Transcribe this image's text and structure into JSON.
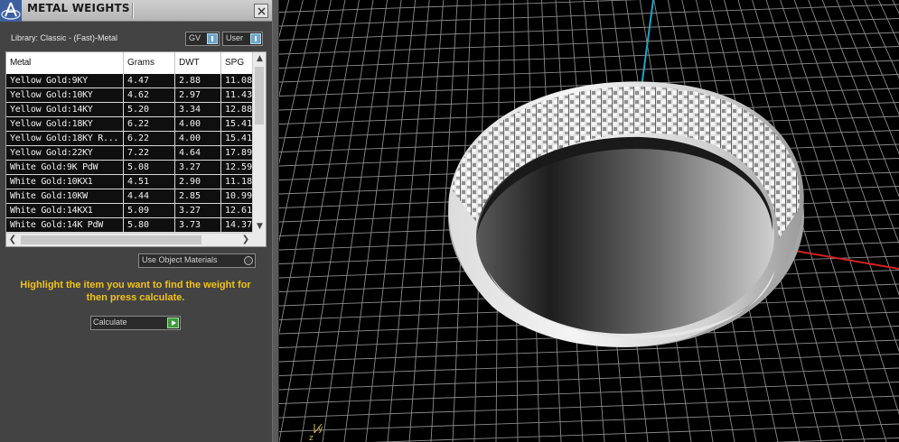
{
  "panel": {
    "title": "METAL WEIGHTS",
    "library_label": "Library: Classic - (Fast)-Metal",
    "toggles": [
      {
        "label": "GV"
      },
      {
        "label": "User"
      }
    ],
    "table": {
      "columns": [
        "Metal",
        "Grams",
        "DWT",
        "SPG"
      ],
      "rows": [
        [
          "Yellow Gold:9KY",
          "4.47",
          "2.88",
          "11.08"
        ],
        [
          "Yellow Gold:10KY",
          "4.62",
          "2.97",
          "11.43"
        ],
        [
          "Yellow Gold:14KY",
          "5.20",
          "3.34",
          "12.88"
        ],
        [
          "Yellow Gold:18KY",
          "6.22",
          "4.00",
          "15.41"
        ],
        [
          "Yellow Gold:18KY R...",
          "6.22",
          "4.00",
          "15.41"
        ],
        [
          "Yellow Gold:22KY",
          "7.22",
          "4.64",
          "17.89"
        ],
        [
          "White Gold:9K PdW",
          "5.08",
          "3.27",
          "12.59"
        ],
        [
          "White Gold:10KX1",
          "4.51",
          "2.90",
          "11.18"
        ],
        [
          "White Gold:10KW",
          "4.44",
          "2.85",
          "10.99"
        ],
        [
          "White Gold:14KX1",
          "5.09",
          "3.27",
          "12.61"
        ],
        [
          "White Gold:14K PdW",
          "5.80",
          "3.73",
          "14.37"
        ]
      ]
    },
    "use_object_materials_label": "Use Object Materials",
    "instructions": "Highlight the item you want to find the weight for then press calculate.",
    "calculate_label": "Calculate"
  },
  "viewport": {
    "axis_labels": {
      "z": "z",
      "y": "y"
    },
    "colors": {
      "grid": "#8a8a8a",
      "x_axis": "#d22222",
      "y_axis": "#1fa6c8",
      "background": "#000000",
      "instructions": "#f2c21a"
    }
  },
  "icons": {
    "app_logo": "app-logo-icon",
    "close": "close-icon",
    "toggle": "toggle-icon",
    "calculate": "play-arrow-icon"
  }
}
